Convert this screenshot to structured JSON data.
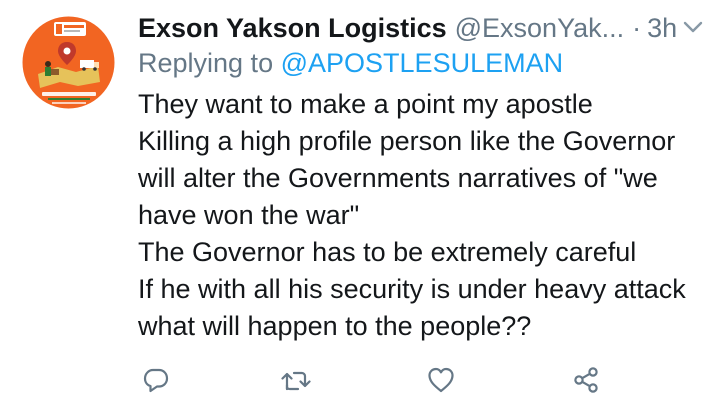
{
  "tweet": {
    "display_name": "Exson Yakson Logistics",
    "handle": "@ExsonYak...",
    "separator": "·",
    "time": "3h",
    "reply_prefix": "Replying to",
    "reply_to": "@APOSTLESULEMAN",
    "lines": [
      "They want to make a point my apostle",
      "Killing a high profile person like the Governor",
      "will alter the Governments narratives of \"we",
      "have won the war\"",
      "The Governor has to be extremely careful",
      "If he with all his security is under heavy attack",
      "what will happen to the people??"
    ]
  },
  "avatar": {
    "logo_text": "Exson Yakson"
  },
  "actions": {
    "icons": [
      "reply-icon",
      "retweet-icon",
      "like-icon",
      "share-icon"
    ]
  },
  "colors": {
    "text_primary": "#14171a",
    "text_secondary": "#657786",
    "link": "#1da1f2",
    "avatar_orange": "#f26522"
  }
}
